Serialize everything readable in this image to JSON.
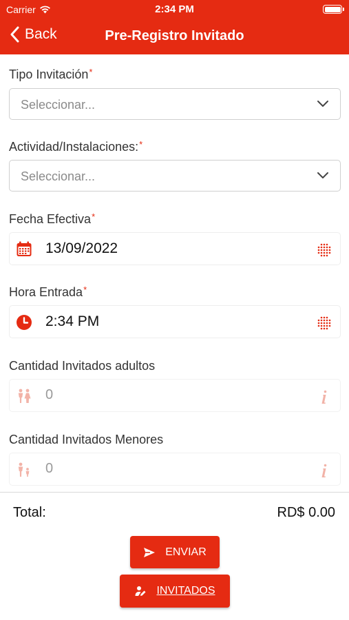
{
  "status_bar": {
    "carrier": "Carrier",
    "time": "2:34 PM"
  },
  "nav": {
    "back_label": "Back",
    "title": "Pre-Registro Invitado"
  },
  "form": {
    "tipo": {
      "label": "Tipo Invitación",
      "required_mark": "*",
      "placeholder": "Seleccionar..."
    },
    "actividad": {
      "label": "Actividad/Instalaciones:",
      "required_mark": "*",
      "placeholder": "Seleccionar..."
    },
    "fecha": {
      "label": "Fecha Efectiva",
      "required_mark": "*",
      "value": "13/09/2022"
    },
    "hora": {
      "label": "Hora Entrada",
      "required_mark": "*",
      "value": "2:34 PM"
    },
    "adultos": {
      "label": "Cantidad Invitados adultos",
      "value": "0"
    },
    "menores": {
      "label": "Cantidad Invitados Menores",
      "value": "0"
    }
  },
  "totals": {
    "label": "Total:",
    "value": "RD$ 0.00"
  },
  "actions": {
    "enviar_label": "ENVIAR",
    "invitados_label": "INVITADOS"
  },
  "colors": {
    "accent": "#e52b12",
    "muted_icon": "#f2b3a8"
  },
  "icons": [
    "wifi-icon",
    "battery-icon",
    "chevron-left-icon",
    "chevron-down-icon",
    "calendar-icon",
    "grid-dots-icon",
    "clock-icon",
    "people-icon",
    "parent-child-icon",
    "info-icon",
    "send-icon",
    "user-edit-icon"
  ]
}
